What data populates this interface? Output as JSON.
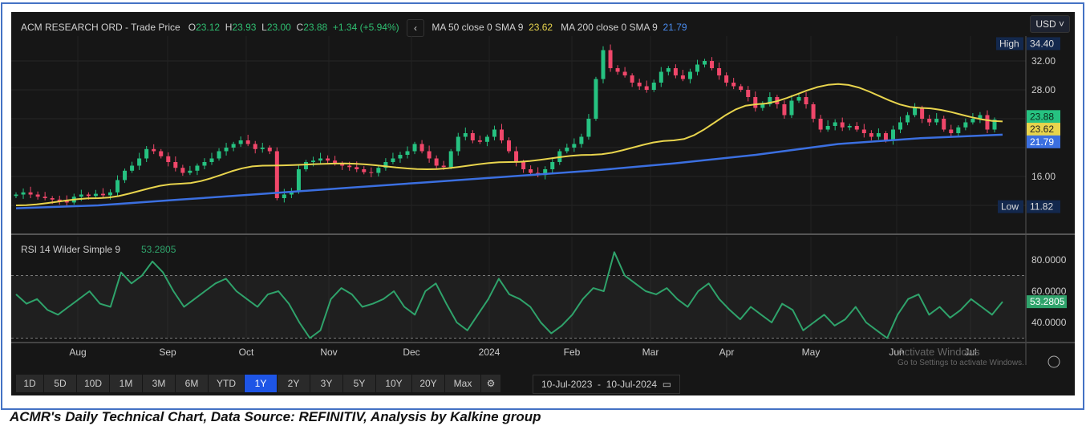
{
  "header": {
    "title": "ACM RESEARCH ORD - Trade Price",
    "o_label": "O",
    "o": "23.12",
    "h_label": "H",
    "h": "23.93",
    "l_label": "L",
    "l": "23.00",
    "c_label": "C",
    "c": "23.88",
    "change": "+1.34 (+5.94%)",
    "ma50_label": "MA 50 close 0 SMA 9",
    "ma50": "23.62",
    "ma200_label": "MA 200 close 0 SMA 9",
    "ma200": "21.79"
  },
  "currency": "USD",
  "rsi_label": "RSI 14 Wilder Simple 9",
  "rsi_value": "53.2805",
  "ranges": [
    "1D",
    "5D",
    "10D",
    "1M",
    "3M",
    "6M",
    "YTD",
    "1Y",
    "2Y",
    "3Y",
    "5Y",
    "10Y",
    "20Y",
    "Max"
  ],
  "active_range": "1Y",
  "date_from": "10-Jul-2023",
  "date_to": "10-Jul-2024",
  "watermark": "Activate Windows",
  "watermark_sub": "Go to Settings to activate Windows.",
  "caption": "ACMR's Daily Technical Chart, Data Source: REFINITIV, Analysis by Kalkine group",
  "colors": {
    "up": "#26c281",
    "down": "#f0476a",
    "ma50": "#e8d44d",
    "ma200": "#3b6fe0",
    "rsi": "#2fa36b"
  },
  "chart_data": {
    "type": "candlestick",
    "title": "ACM RESEARCH ORD - Trade Price",
    "x_ticks": [
      "Aug",
      "Sep",
      "Oct",
      "Nov",
      "Dec",
      "2024",
      "Feb",
      "Mar",
      "Apr",
      "May",
      "Jun",
      "Jul"
    ],
    "y_ticks": [
      "32.00",
      "28.00",
      "16.00"
    ],
    "ylim": [
      11.82,
      34.4
    ],
    "high_label": "High",
    "high": "34.40",
    "low_label": "Low",
    "low": "11.82",
    "close": [
      13.5,
      13.8,
      13.5,
      13.2,
      13.0,
      12.8,
      12.6,
      12.4,
      13.2,
      13.5,
      13.3,
      13.6,
      13.4,
      13.8,
      15.5,
      16.8,
      17.5,
      18.5,
      19.8,
      19.5,
      18.8,
      18.0,
      17.2,
      16.5,
      16.8,
      17.5,
      18.0,
      18.5,
      19.5,
      20.0,
      20.5,
      21.0,
      20.5,
      19.8,
      20.0,
      19.5,
      13.0,
      13.5,
      14.0,
      17.0,
      18.0,
      18.2,
      18.5,
      18.2,
      17.8,
      17.5,
      17.3,
      17.0,
      16.6,
      16.5,
      17.2,
      18.0,
      18.5,
      19.0,
      19.5,
      20.5,
      19.5,
      18.5,
      17.5,
      17.3,
      19.5,
      21.5,
      22.0,
      21.0,
      20.8,
      21.5,
      22.5,
      21.0,
      19.5,
      18.0,
      17.0,
      16.5,
      16.2,
      17.0,
      18.0,
      19.5,
      20.0,
      20.5,
      21.5,
      24.0,
      29.5,
      33.5,
      31.0,
      30.5,
      30.0,
      29.0,
      28.5,
      28.0,
      29.0,
      30.5,
      31.0,
      30.0,
      29.5,
      30.5,
      31.5,
      32.0,
      31.0,
      30.0,
      29.0,
      28.5,
      28.0,
      27.0,
      25.5,
      26.0,
      27.0,
      26.0,
      24.5,
      26.5,
      27.0,
      26.0,
      24.0,
      22.5,
      23.0,
      23.5,
      22.8,
      23.0,
      22.5,
      22.0,
      21.5,
      22.0,
      21.0,
      22.5,
      23.5,
      24.5,
      25.5,
      24.0,
      23.5,
      24.0,
      22.5,
      22.0,
      22.8,
      23.5,
      24.0,
      24.5,
      22.5,
      23.88
    ],
    "ma50": [
      12.0,
      13.0,
      15.0,
      17.5,
      17.8,
      17.0,
      18.0,
      19.0,
      21.0,
      26.0,
      28.8,
      25.5,
      23.62
    ],
    "ma200": [
      11.6,
      12.0,
      12.8,
      13.6,
      14.4,
      15.2,
      16.0,
      16.8,
      17.8,
      19.0,
      20.5,
      21.3,
      21.79
    ],
    "rsi": {
      "y_ticks": [
        "80.0000",
        "60.0000",
        "40.0000"
      ],
      "ylim": [
        25,
        88
      ],
      "bands": [
        70,
        30
      ],
      "values": [
        58,
        52,
        55,
        48,
        45,
        50,
        55,
        60,
        52,
        50,
        72,
        65,
        70,
        79,
        72,
        60,
        50,
        55,
        60,
        65,
        68,
        60,
        55,
        50,
        58,
        60,
        52,
        40,
        30,
        35,
        55,
        62,
        58,
        50,
        52,
        55,
        60,
        50,
        45,
        60,
        65,
        52,
        40,
        35,
        45,
        55,
        68,
        58,
        55,
        50,
        40,
        33,
        38,
        45,
        55,
        62,
        60,
        85,
        70,
        65,
        60,
        58,
        62,
        55,
        50,
        60,
        65,
        55,
        48,
        42,
        50,
        45,
        40,
        52,
        48,
        35,
        40,
        45,
        38,
        42,
        50,
        40,
        35,
        30,
        45,
        55,
        58,
        45,
        50,
        43,
        48,
        55,
        50,
        45,
        53.28
      ]
    }
  }
}
